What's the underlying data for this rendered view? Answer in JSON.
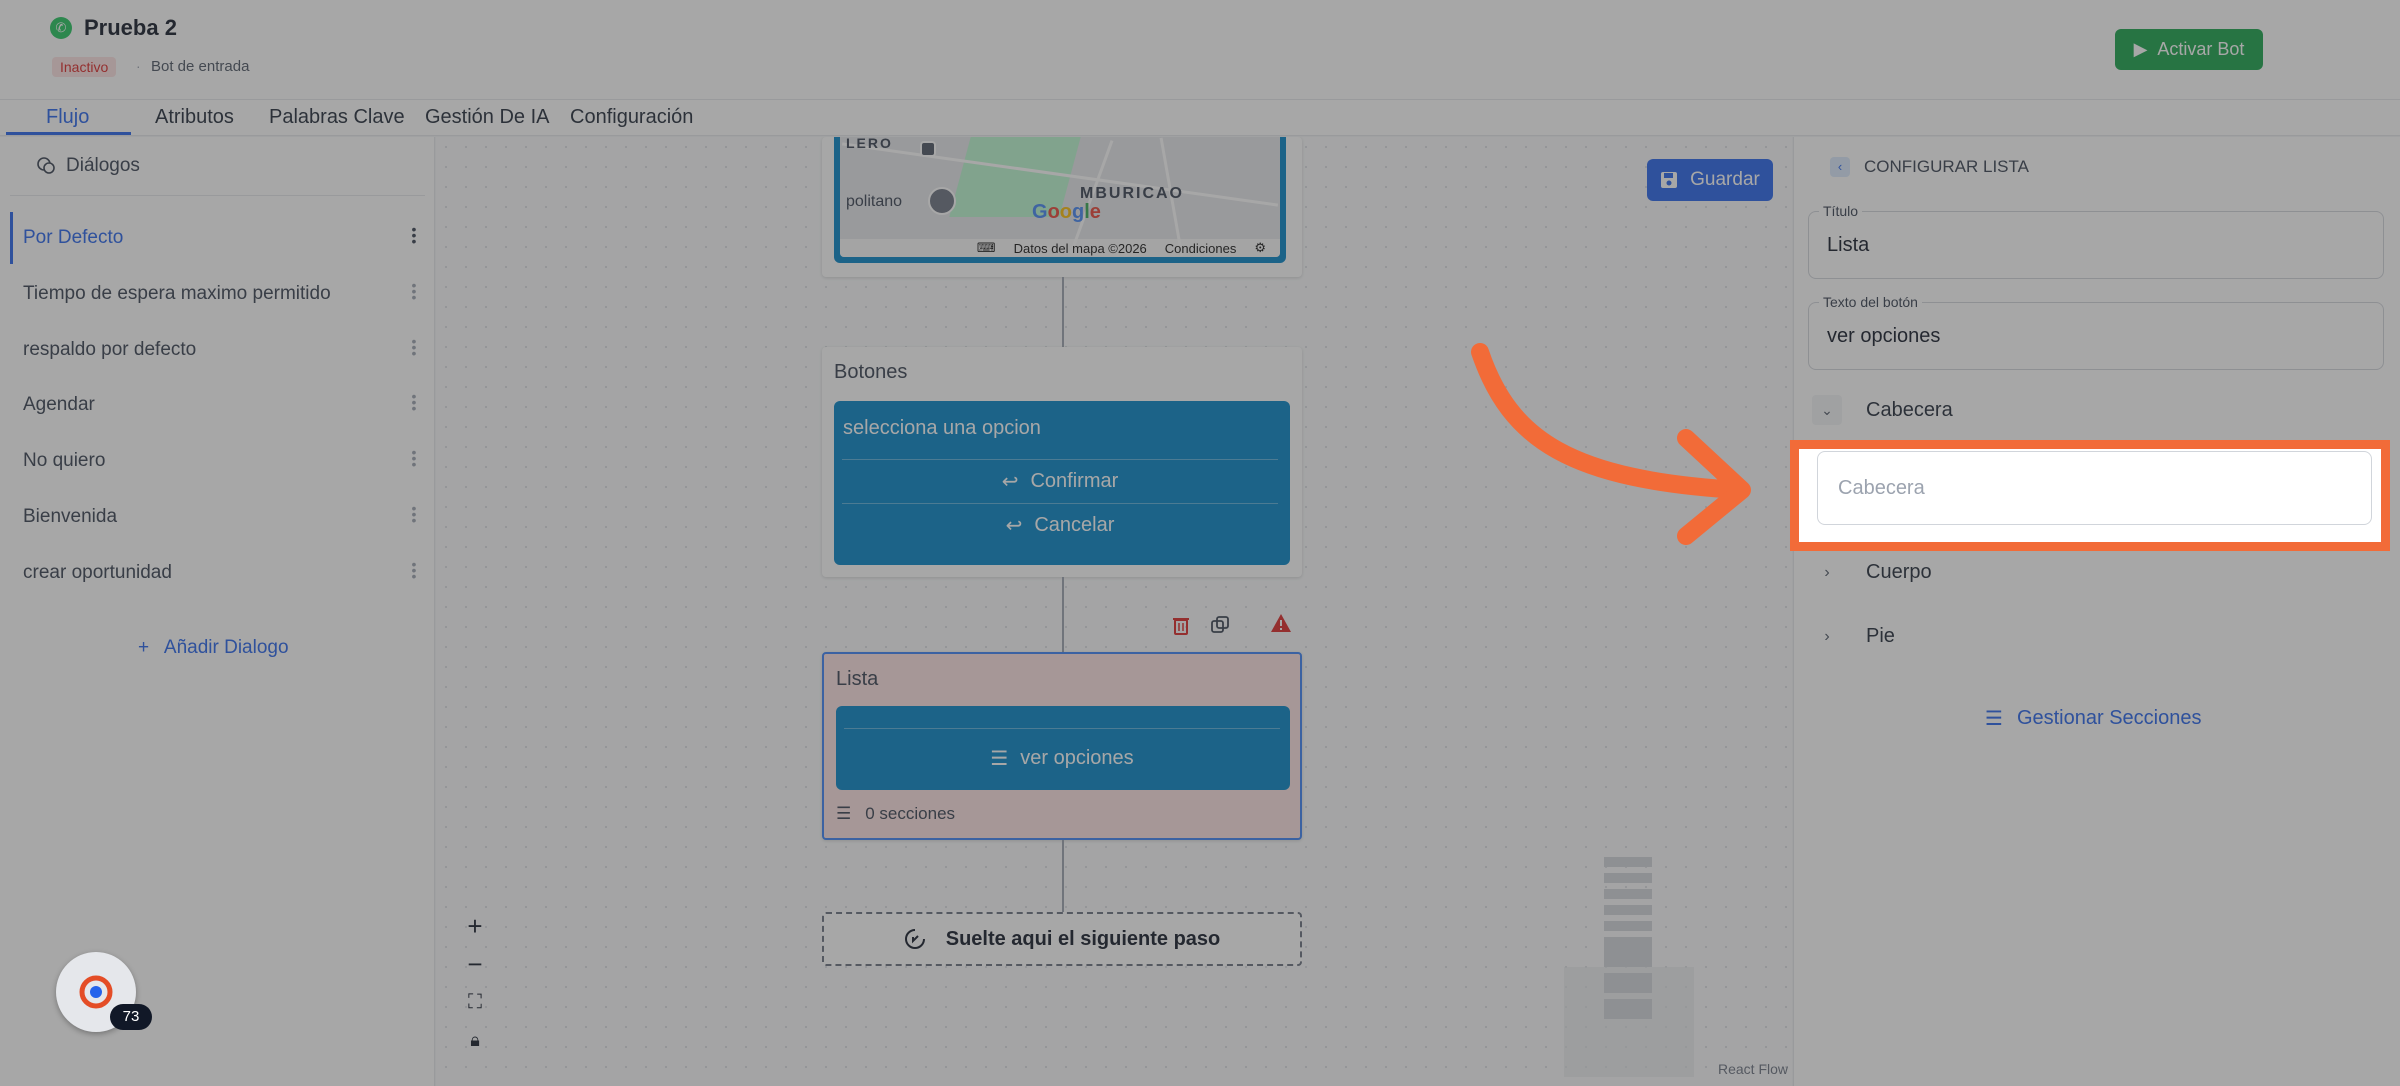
{
  "header": {
    "bot_name": "Prueba 2",
    "status": "Inactivo",
    "separator": "·",
    "bot_type": "Bot de entrada",
    "activate_label": "Activar Bot"
  },
  "tabs": [
    {
      "label": "Flujo",
      "active": true
    },
    {
      "label": "Atributos"
    },
    {
      "label": "Palabras Clave"
    },
    {
      "label": "Gestión De IA"
    },
    {
      "label": "Configuración"
    }
  ],
  "sidebar": {
    "title": "Diálogos",
    "items": [
      {
        "label": "Por Defecto",
        "selected": true
      },
      {
        "label": "Tiempo de espera maximo permitido"
      },
      {
        "label": "respaldo por defecto"
      },
      {
        "label": "Agendar"
      },
      {
        "label": "No quiero"
      },
      {
        "label": "Bienvenida"
      },
      {
        "label": "crear oportunidad"
      }
    ],
    "add_label": "Añadir Dialogo"
  },
  "canvas": {
    "save_label": "Guardar",
    "map": {
      "label_top": "LERO",
      "label_left": "politano",
      "label_area": "MBURICAO",
      "google": "Google",
      "data_label": "Datos del mapa ©2026",
      "terms_label": "Condiciones"
    },
    "buttons_node": {
      "title": "Botones",
      "text": "selecciona una opcion",
      "options": [
        "Confirmar",
        "Cancelar"
      ]
    },
    "list_node": {
      "title": "Lista",
      "button_text": "ver opciones",
      "sections_count": "0 secciones"
    },
    "drop_zone_label": "Suelte aqui el siguiente paso",
    "zoom": {
      "in": "+",
      "out": "−"
    },
    "attribution": "React Flow"
  },
  "panel": {
    "title": "CONFIGURAR LISTA",
    "title_field": {
      "label": "Título",
      "value": "Lista"
    },
    "button_field": {
      "label": "Texto del botón",
      "value": "ver opciones"
    },
    "sections": [
      {
        "label": "Cabecera",
        "expanded": true,
        "placeholder": "Cabecera"
      },
      {
        "label": "Cuerpo",
        "expanded": false
      },
      {
        "label": "Pie",
        "expanded": false
      }
    ],
    "manage_label": "Gestionar Secciones"
  },
  "widget": {
    "count": "73"
  },
  "colors": {
    "primary": "#2563eb",
    "node_blue": "#0284c7",
    "success": "#16a34a",
    "highlight": "#f26b38",
    "error_bg": "#fee2e2"
  }
}
